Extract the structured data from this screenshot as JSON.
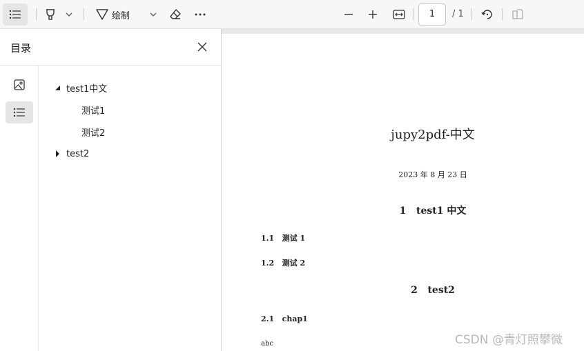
{
  "toolbar": {
    "icons": [
      "toc-list-icon",
      "highlight-icon",
      "chevron-down-icon",
      "draw-icon",
      "chevron-down-icon",
      "eraser-icon",
      "more-icon",
      "zoom-out-icon",
      "zoom-in-icon",
      "fit-width-icon",
      "rotate-icon",
      "page-view-icon"
    ],
    "draw_label": "绘制",
    "page_value": "1",
    "page_total": "/ 1"
  },
  "sidebar": {
    "title": "目录",
    "rail": [
      "thumbnail-icon",
      "outline-list-icon"
    ],
    "tree": [
      {
        "label": "test1中文",
        "expanded": true,
        "children": [
          {
            "label": "测试1"
          },
          {
            "label": "测试2"
          }
        ]
      },
      {
        "label": "test2",
        "expanded": false,
        "children": []
      }
    ]
  },
  "document": {
    "title": "jupy2pdf-中文",
    "date": "2023 年 8 月 23 日",
    "sections": [
      {
        "number": "1",
        "title": "test1 中文",
        "subsections": [
          {
            "number": "1.1",
            "title": "测试 1"
          },
          {
            "number": "1.2",
            "title": "测试 2"
          }
        ]
      },
      {
        "number": "2",
        "title": "test2",
        "subsections": [
          {
            "number": "2.1",
            "title": "chap1"
          }
        ]
      }
    ],
    "body_text": "abc"
  },
  "watermark": "CSDN @青灯照攀微",
  "colors": {
    "toolbar_bg": "#f7f7f7",
    "active_bg": "#e6e6e6",
    "gutter": "#e8e8e8"
  }
}
